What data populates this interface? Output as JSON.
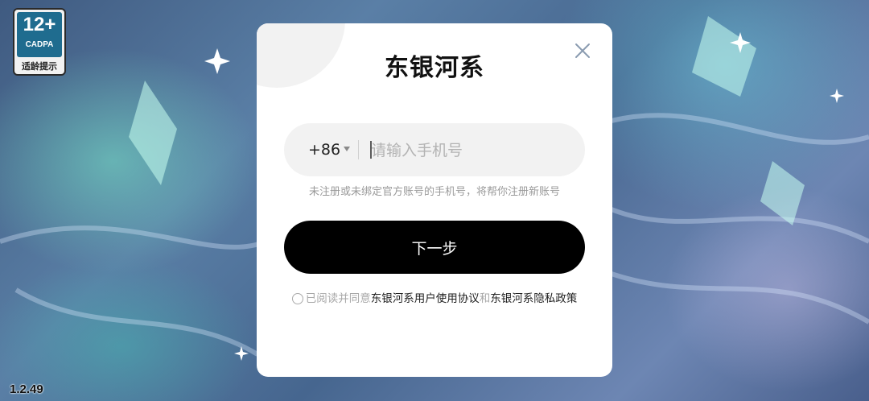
{
  "rating": {
    "age": "12+",
    "org": "CADPA",
    "hint": "适龄提示"
  },
  "version": "1.2.49",
  "modal": {
    "brand": "东银河系",
    "phone": {
      "country_code": "+86",
      "placeholder": "请输入手机号",
      "value": ""
    },
    "hint": "未注册或未绑定官方账号的手机号，将帮你注册新账号",
    "next_label": "下一步",
    "agreement": {
      "prefix": "已阅读并同意",
      "link1": "东银河系用户使用协议",
      "joiner": "和",
      "link2": "东银河系隐私政策",
      "checked": false
    }
  },
  "colors": {
    "modal_bg": "#ffffff",
    "button_bg": "#000000",
    "input_bg": "#f2f2f2",
    "rating_badge": "#1f6c8f"
  },
  "icons": [
    "close-icon",
    "dropdown-caret-icon",
    "radio-icon"
  ]
}
